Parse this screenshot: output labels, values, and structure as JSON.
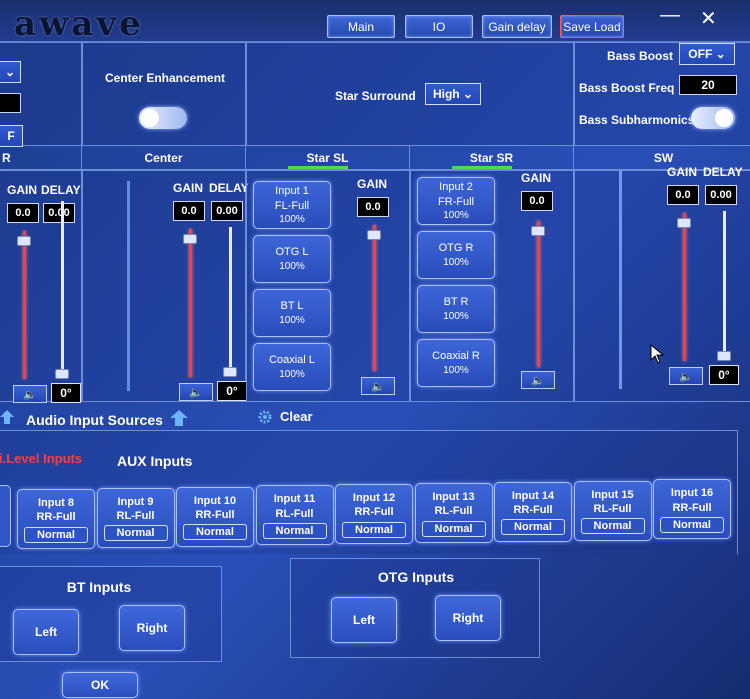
{
  "app": {
    "logo": "awave"
  },
  "toolbar": {
    "main_label": "Main",
    "io_label": "IO",
    "gain_delay_label": "Gain delay",
    "save_load_label": "Save Load",
    "minimize_glyph": "—",
    "close_glyph": "✕"
  },
  "top_left": {
    "dropdown_glyph": "⌄",
    "dropdown2_value": "F"
  },
  "center_enhancement": {
    "label": "Center Enhancement",
    "toggle_state": "on"
  },
  "star_surround": {
    "label": "Star Surround",
    "value": "High"
  },
  "bass": {
    "boost_label": "Bass Boost",
    "boost_value": "OFF",
    "boost_freq_label": "Bass Boost Freq",
    "boost_freq_value": "20",
    "subharmonics_label": "Bass Subharmonics",
    "subharmonics_state": "on"
  },
  "channels": {
    "left_partial": {
      "name": "R",
      "gain_label": "GAIN",
      "delay_label": "DELAY",
      "gain": "0.0",
      "delay": "0.00",
      "phase": "0°",
      "gain_level": 0.95,
      "delay_level": 0.0
    },
    "center": {
      "name": "Center",
      "gain_label": "GAIN",
      "delay_label": "DELAY",
      "gain": "0.0",
      "delay": "0.00",
      "phase": "0°",
      "gain_level": 0.95,
      "delay_level": 0.0
    },
    "star_sl": {
      "name": "Star SL",
      "gain_label": "GAIN",
      "gain": "0.0",
      "gain_level": 0.95,
      "sources": [
        {
          "line1": "Input 1",
          "line2": "FL-Full",
          "pct": "100%"
        },
        {
          "line1": "OTG L",
          "line2": "",
          "pct": "100%"
        },
        {
          "line1": "BT L",
          "line2": "",
          "pct": "100%"
        },
        {
          "line1": "Coaxial L",
          "line2": "",
          "pct": "100%"
        }
      ]
    },
    "star_sr": {
      "name": "Star SR",
      "gain_label": "GAIN",
      "gain": "0.0",
      "gain_level": 0.95,
      "sources": [
        {
          "line1": "Input 2",
          "line2": "FR-Full",
          "pct": "100%"
        },
        {
          "line1": "OTG R",
          "line2": "",
          "pct": "100%"
        },
        {
          "line1": "BT R",
          "line2": "",
          "pct": "100%"
        },
        {
          "line1": "Coaxial R",
          "line2": "",
          "pct": "100%"
        }
      ]
    },
    "sw": {
      "name": "SW",
      "gain_label": "GAIN",
      "delay_label": "DELAY",
      "gain": "0.0",
      "delay": "0.00",
      "phase": "0°",
      "gain_level": 0.95,
      "delay_level": 0.0
    }
  },
  "speaker_icon_glyph": "🔈",
  "audio_sources": {
    "title": "Audio Input Sources",
    "clear_label": "Clear",
    "tab_high_level": "i.Level Inputs",
    "tab_aux": "AUX Inputs",
    "aux_inputs": [
      {
        "name": "Input 8",
        "assign": "RR-Full",
        "mode": "Normal"
      },
      {
        "name": "Input 9",
        "assign": "RL-Full",
        "mode": "Normal"
      },
      {
        "name": "Input 10",
        "assign": "RR-Full",
        "mode": "Normal"
      },
      {
        "name": "Input 11",
        "assign": "RL-Full",
        "mode": "Normal"
      },
      {
        "name": "Input 12",
        "assign": "RR-Full",
        "mode": "Normal"
      },
      {
        "name": "Input 13",
        "assign": "RL-Full",
        "mode": "Normal"
      },
      {
        "name": "Input 14",
        "assign": "RR-Full",
        "mode": "Normal"
      },
      {
        "name": "Input 15",
        "assign": "RL-Full",
        "mode": "Normal"
      },
      {
        "name": "Input 16",
        "assign": "RR-Full",
        "mode": "Normal"
      }
    ],
    "bt": {
      "title": "BT Inputs",
      "left": "Left",
      "right": "Right"
    },
    "otg": {
      "title": "OTG Inputs",
      "left": "Left",
      "right": "Right"
    }
  },
  "ok_label": "OK",
  "colors": {
    "accent": "#2a4fb8",
    "gain_track": "#ff3b3b",
    "active_tab": "#ff3b3b",
    "green_indicator": "#3fe83f"
  }
}
